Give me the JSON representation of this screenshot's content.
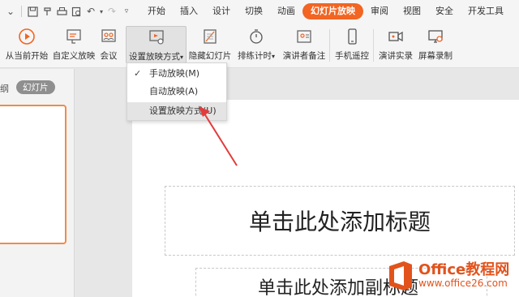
{
  "menubar": {
    "tabs": [
      "开始",
      "插入",
      "设计",
      "切换",
      "动画",
      "幻灯片放映",
      "审阅",
      "视图",
      "安全",
      "开发工具"
    ],
    "active_tab": "幻灯片放映",
    "accent": "#f26522"
  },
  "ribbon": {
    "buttons": [
      {
        "label": "从当前开始",
        "icon": "play-circle-icon"
      },
      {
        "label": "自定义放映",
        "icon": "custom-show-icon"
      },
      {
        "label": "会议",
        "icon": "meeting-icon"
      },
      {
        "label": "设置放映方式",
        "icon": "setup-show-icon",
        "has_dropdown": true
      },
      {
        "label": "隐藏幻灯片",
        "icon": "hide-slide-icon"
      },
      {
        "label": "排练计时",
        "icon": "stopwatch-icon",
        "has_dropdown": true
      },
      {
        "label": "演讲者备注",
        "icon": "speaker-notes-icon"
      },
      {
        "label": "手机遥控",
        "icon": "phone-icon"
      },
      {
        "label": "演讲实录",
        "icon": "video-record-icon"
      },
      {
        "label": "屏幕录制",
        "icon": "screen-record-icon"
      }
    ]
  },
  "dropdown": {
    "items": [
      {
        "label": "手动放映(M)",
        "checked": true
      },
      {
        "label": "自动放映(A)",
        "checked": false
      },
      {
        "label": "设置放映方式(U)",
        "checked": false,
        "highlighted": true
      }
    ]
  },
  "leftpanel": {
    "tab_outline": "纲",
    "tab_slides": "幻灯片"
  },
  "slide": {
    "title_placeholder": "单击此处添加标题",
    "subtitle_placeholder": "单击此处添加副标题"
  },
  "logo": {
    "name": "Office教程网",
    "url": "www.office26.com"
  }
}
